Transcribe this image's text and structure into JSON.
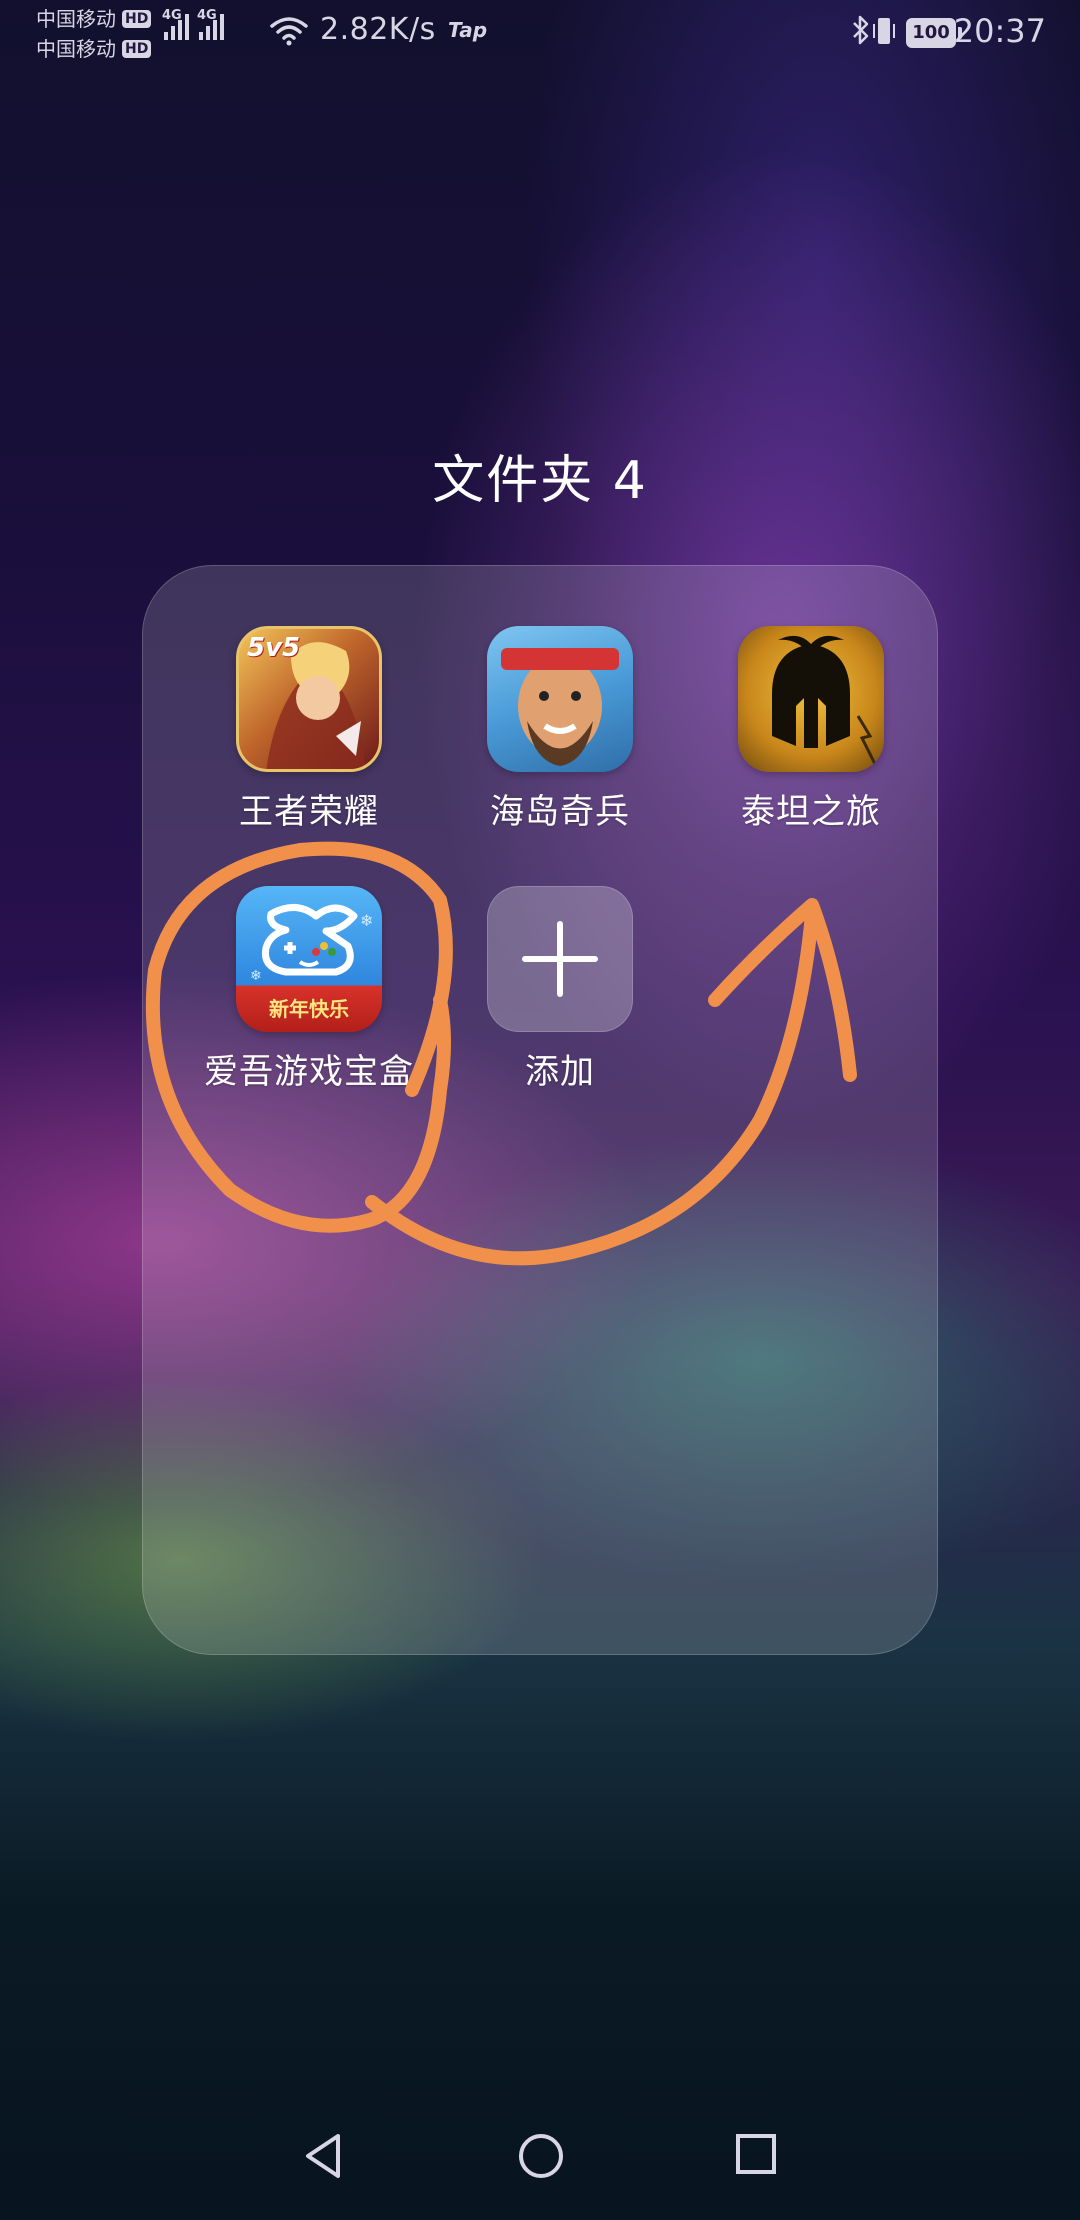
{
  "status_bar": {
    "carrier_1": "中国移动",
    "carrier_2": "中国移动",
    "hd_label": "HD",
    "network_tag": "4G",
    "net_speed": "2.82K/s",
    "tap_label": "Tap",
    "battery": "100",
    "time": "20:37"
  },
  "folder": {
    "title": "文件夹 4",
    "apps": [
      {
        "label": "王者荣耀",
        "icon": "honor-of-kings-icon",
        "badge_text": "5v5"
      },
      {
        "label": "海岛奇兵",
        "icon": "boom-beach-icon"
      },
      {
        "label": "泰坦之旅",
        "icon": "titan-quest-icon"
      },
      {
        "label": "爱吾游戏宝盒",
        "icon": "aiwu-game-box-icon",
        "banner_text": "新年快乐"
      },
      {
        "label": "添加",
        "icon": "plus-icon"
      }
    ]
  },
  "annotation": {
    "color": "#f0904a"
  },
  "nav_bar": {
    "buttons": [
      "back-icon",
      "home-icon",
      "recents-icon"
    ]
  }
}
